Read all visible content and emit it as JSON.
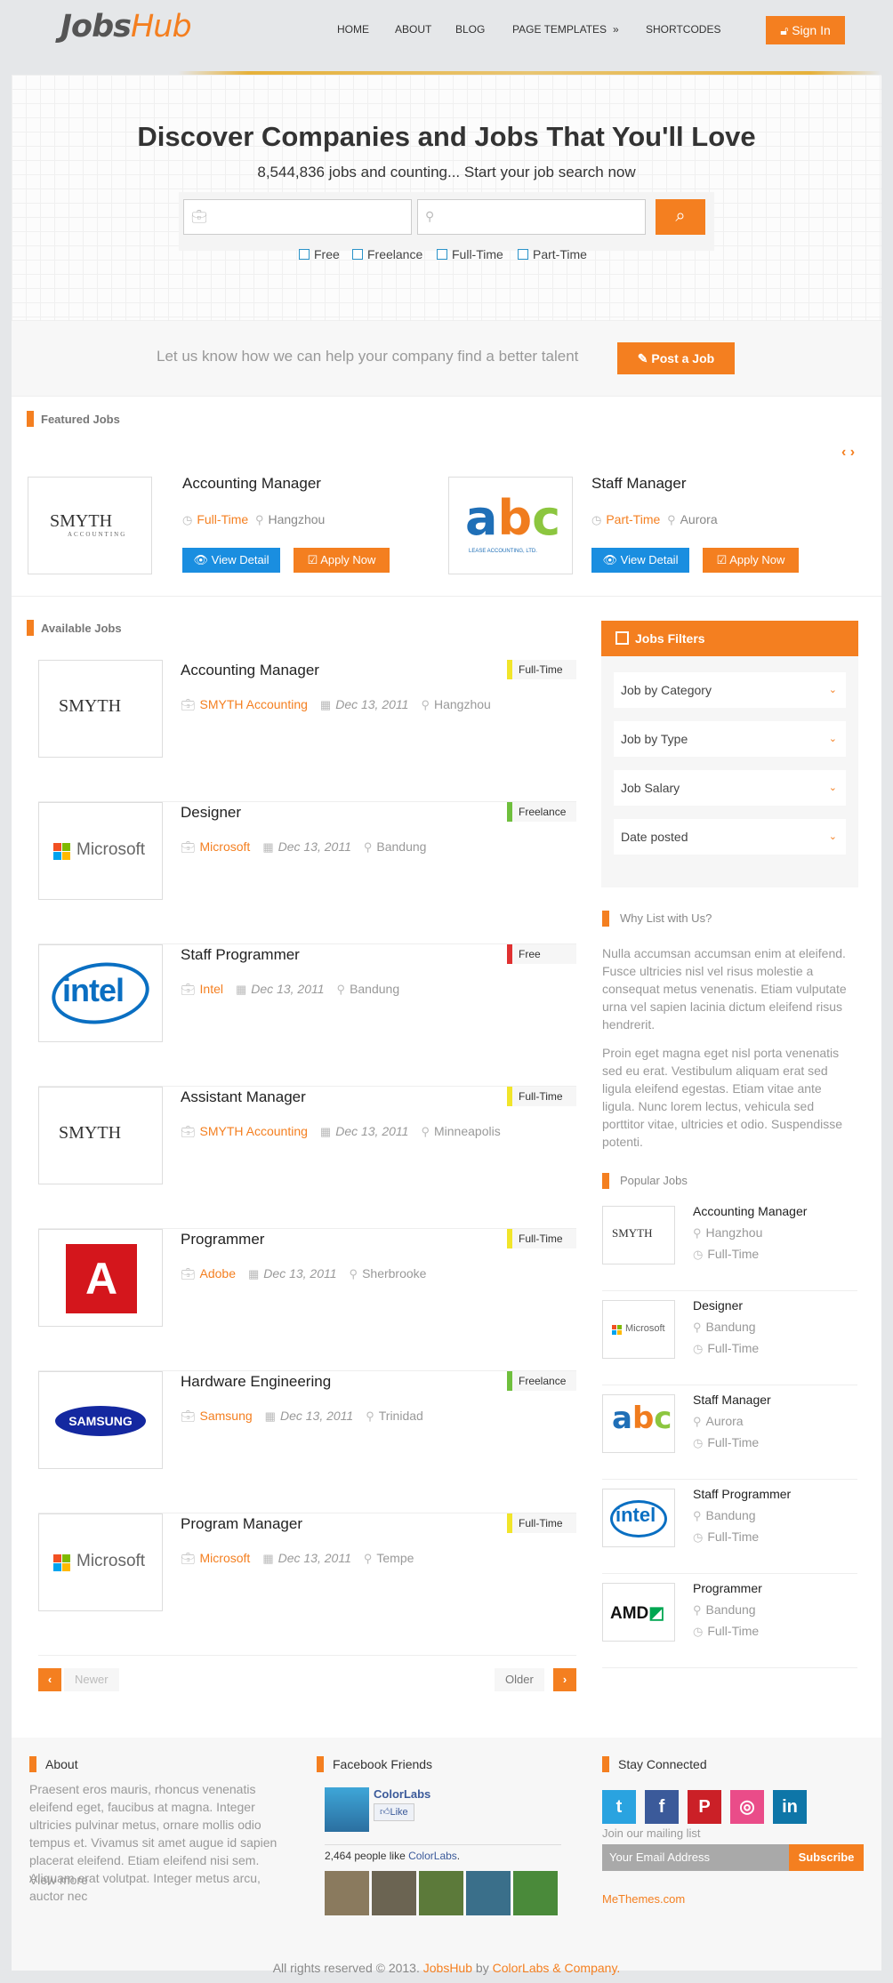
{
  "header": {
    "logo_part1": "Jobs",
    "logo_part2": "Hub",
    "nav": [
      "HOME",
      "ABOUT",
      "BLOG",
      "PAGE TEMPLATES",
      "SHORTCODES"
    ],
    "nav_arrow": "»",
    "signin": "Sign In"
  },
  "hero": {
    "title": "Discover Companies and Jobs That You'll Love",
    "subtitle": "8,544,836 jobs and counting... Start your job search now",
    "types": [
      "Free",
      "Freelance",
      "Full-Time",
      "Part-Time"
    ]
  },
  "cta": {
    "text": "Let us know how we can help your company find a better talent",
    "button": "Post a Job"
  },
  "featured": {
    "heading": "Featured Jobs",
    "nav_arrows": "‹ ›",
    "jobs": [
      {
        "title": "Accounting Manager",
        "type": "Full-Time",
        "location": "Hangzhou",
        "logo": "SMYTH",
        "logo_sub": "ACCOUNTING"
      },
      {
        "title": "Staff Manager",
        "type": "Part-Time",
        "location": "Aurora",
        "logo": "abc",
        "logo_sub": "LEASE ACCOUNTING, LTD."
      }
    ],
    "view_label": "View Detail",
    "apply_label": "Apply Now"
  },
  "available": {
    "heading": "Available Jobs",
    "jobs": [
      {
        "title": "Accounting Manager",
        "company": "SMYTH Accounting",
        "date": "Dec 13, 2011",
        "location": "Hangzhou",
        "type": "Full-Time",
        "logo": "SMYTH"
      },
      {
        "title": "Designer",
        "company": "Microsoft",
        "date": "Dec 13, 2011",
        "location": "Bandung",
        "type": "Freelance",
        "logo": "Microsoft"
      },
      {
        "title": "Staff Programmer",
        "company": "Intel",
        "date": "Dec 13, 2011",
        "location": "Bandung",
        "type": "Free",
        "logo": "intel"
      },
      {
        "title": "Assistant Manager",
        "company": "SMYTH Accounting",
        "date": "Dec 13, 2011",
        "location": "Minneapolis",
        "type": "Full-Time",
        "logo": "SMYTH"
      },
      {
        "title": "Programmer",
        "company": "Adobe",
        "date": "Dec 13, 2011",
        "location": "Sherbrooke",
        "type": "Full-Time",
        "logo": "Adobe"
      },
      {
        "title": "Hardware Engineering",
        "company": "Samsung",
        "date": "Dec 13, 2011",
        "location": "Trinidad",
        "type": "Freelance",
        "logo": "SAMSUNG"
      },
      {
        "title": "Program Manager",
        "company": "Microsoft",
        "date": "Dec 13, 2011",
        "location": "Tempe",
        "type": "Full-Time",
        "logo": "Microsoft"
      }
    ],
    "newer": "Newer",
    "older": "Older"
  },
  "filters": {
    "heading": "Jobs Filters",
    "selects": [
      "Job by Category",
      "Job by Type",
      "Job Salary",
      "Date posted"
    ]
  },
  "why": {
    "heading": "Why List with Us?",
    "p1": "Nulla accumsan accumsan enim at eleifend. Fusce ultricies nisl vel risus molestie a consequat metus venenatis. Etiam vulputate urna vel sapien lacinia dictum eleifend risus hendrerit.",
    "p2": "Proin eget magna eget nisl porta venenatis sed eu erat. Vestibulum aliquam erat sed ligula eleifend egestas. Etiam vitae ante ligula. Nunc lorem lectus, vehicula sed porttitor vitae, ultricies et odio. Suspendisse potenti."
  },
  "popular": {
    "heading": "Popular Jobs",
    "jobs": [
      {
        "title": "Accounting Manager",
        "location": "Hangzhou",
        "type": "Full-Time",
        "logo": "SMYTH"
      },
      {
        "title": "Designer",
        "location": "Bandung",
        "type": "Full-Time",
        "logo": "Microsoft"
      },
      {
        "title": "Staff Manager",
        "location": "Aurora",
        "type": "Full-Time",
        "logo": "abc"
      },
      {
        "title": "Staff Programmer",
        "location": "Bandung",
        "type": "Full-Time",
        "logo": "intel"
      },
      {
        "title": "Programmer",
        "location": "Bandung",
        "type": "Full-Time",
        "logo": "AMD"
      }
    ]
  },
  "footer": {
    "about_title": "About",
    "about_text": "Praesent eros mauris, rhoncus venenatis eleifend eget, faucibus at magna. Integer ultricies pulvinar metus, ornare mollis odio tempus et. Vivamus sit amet augue id sapien placerat eleifend. Etiam eleifend nisi sem. Aliquam erat volutpat. Integer metus arcu, auctor nec",
    "view_more": "View more",
    "fb_title": "Facebook Friends",
    "fb_page": "ColorLabs",
    "fb_like": "Like",
    "fb_count": "2,464 people like",
    "fb_count_link": "ColorLabs",
    "fb_count_end": ".",
    "stay_title": "Stay Connected",
    "social": [
      "t",
      "f",
      "P",
      "◎",
      "in"
    ],
    "mailing": "Join our mailing list",
    "email_placeholder": "Your Email Address",
    "subscribe": "Subscribe",
    "site": "MeThemes.com"
  },
  "copyright": {
    "pre": "All rights reserved © 2013.",
    "brand": "JobsHub",
    "by": "by",
    "company": "ColorLabs & Company."
  },
  "colors": {
    "accent": "#f47f20",
    "blue": "#1a8ee0",
    "twitter": "#2aa3e0",
    "facebook": "#3b5a9a",
    "pinterest": "#cb2027",
    "dribbble": "#ea4c89",
    "linkedin": "#0e76a8"
  }
}
